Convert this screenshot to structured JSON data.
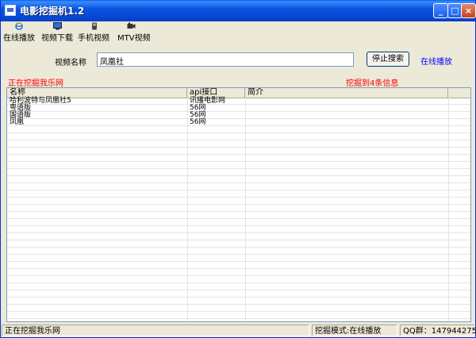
{
  "window": {
    "title": "电影挖掘机1.2"
  },
  "toolbar": {
    "items": [
      {
        "label": "在线播放",
        "icon": "ie-icon"
      },
      {
        "label": "视频下载",
        "icon": "monitor-icon"
      },
      {
        "label": "手机视频",
        "icon": "phone-icon"
      },
      {
        "label": "MTV视频",
        "icon": "camera-icon"
      }
    ]
  },
  "search": {
    "label": "视频名称",
    "value": "凤凰社",
    "button": "停止搜索",
    "mode_link": "在线播放"
  },
  "status_msgs": {
    "left": "正在挖掘我乐网",
    "right": "挖掘到4条信息"
  },
  "table": {
    "columns": [
      "名称",
      "api接口",
      "简介"
    ],
    "rows": [
      [
        "哈利波特与凤凰社5",
        "讯播电影网",
        ""
      ],
      [
        "粤语版",
        "56网",
        ""
      ],
      [
        "国语版",
        "56网",
        ""
      ],
      [
        "凤凰",
        "56网",
        ""
      ]
    ]
  },
  "statusbar": {
    "left": "正在挖掘我乐网",
    "mode": "挖掘模式:在线播放",
    "qq": "QQ群：147944275"
  },
  "colors": {
    "accent_red": "#ff0000",
    "link_blue": "#0000ff",
    "title_blue": "#0a5fe8"
  }
}
